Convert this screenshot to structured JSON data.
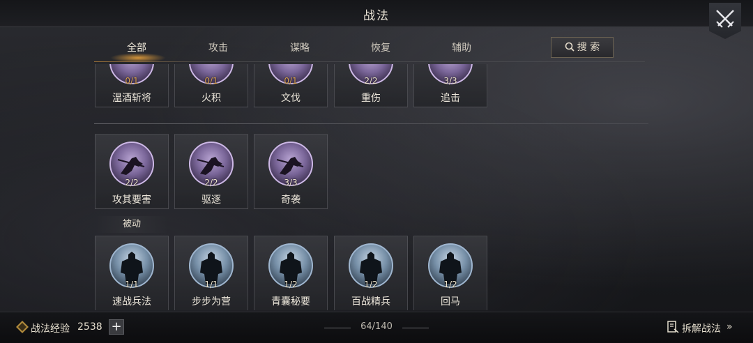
{
  "header": {
    "title": "战法"
  },
  "tabs": [
    {
      "label": "全部",
      "active": true
    },
    {
      "label": "攻击",
      "active": false
    },
    {
      "label": "谋略",
      "active": false
    },
    {
      "label": "恢复",
      "active": false
    },
    {
      "label": "辅助",
      "active": false
    }
  ],
  "search": {
    "label": "搜 索"
  },
  "row1": [
    {
      "name": "温酒斩将",
      "count": "0/1"
    },
    {
      "name": "火积",
      "count": "0/1"
    },
    {
      "name": "文伐",
      "count": "0/1"
    },
    {
      "name": "重伤",
      "count": "2/2"
    },
    {
      "name": "追击",
      "count": "3/3"
    }
  ],
  "row2": [
    {
      "name": "攻其要害",
      "count": "2/2"
    },
    {
      "name": "驱逐",
      "count": "2/2"
    },
    {
      "name": "奇袭",
      "count": "3/3"
    }
  ],
  "passive": {
    "label": "被动",
    "items": [
      {
        "name": "速战兵法",
        "count": "1/1"
      },
      {
        "name": "步步为营",
        "count": "1/1"
      },
      {
        "name": "青囊秘要",
        "count": "1/2"
      },
      {
        "name": "百战精兵",
        "count": "1/2"
      },
      {
        "name": "回马",
        "count": "1/2"
      }
    ]
  },
  "footer": {
    "exp_label": "战法经验",
    "exp_value": "2538",
    "page": "64/140",
    "dismantle_label": "拆解战法",
    "dismantle_arrow": "»"
  },
  "colors": {
    "accent": "#d9a34f",
    "orb_active": "#7a6699",
    "orb_passive": "#7790a8"
  },
  "icons": [
    "close-crossed-swords-icon",
    "search-icon",
    "exp-badge-icon",
    "plus-icon",
    "dismantle-icon"
  ]
}
